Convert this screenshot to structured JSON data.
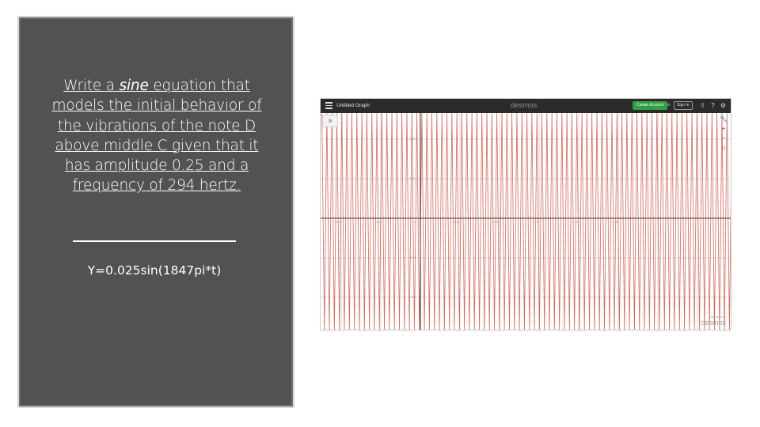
{
  "slide": {
    "question_prefix": "Write a ",
    "question_emph": "sine",
    "question_suffix": " equation that models the initial behavior of the vibrations of the note D above middle C given that it has amplitude 0.25 and a frequency of 294 hertz.",
    "answer": "Y=0.025sin(1847pi*t)"
  },
  "desmos": {
    "title": "Untitled Graph",
    "brand": "desmos",
    "create_account": "Create Account",
    "or": "or",
    "sign_in": "Sign In",
    "expand_icon": "double-chevron-icon",
    "toolbar_icons": [
      "share-icon",
      "help-icon",
      "settings-icon"
    ],
    "side_icons": [
      "wrench-icon",
      "zoom-in-icon",
      "zoom-out-icon",
      "home-icon"
    ],
    "expand_glyph": "»",
    "powered_by": "powered by",
    "powered_brand": "desmos",
    "x_tick_labels": [
      "-0.02",
      "-0.01",
      "0",
      "0.01",
      "0.02",
      "0.03",
      "0.04",
      "0.05"
    ],
    "y_tick_labels": [
      "0.02",
      "0.01",
      "-0.01",
      "-0.02"
    ],
    "curve_color": "#c0392b",
    "cycles_visible": 82
  }
}
